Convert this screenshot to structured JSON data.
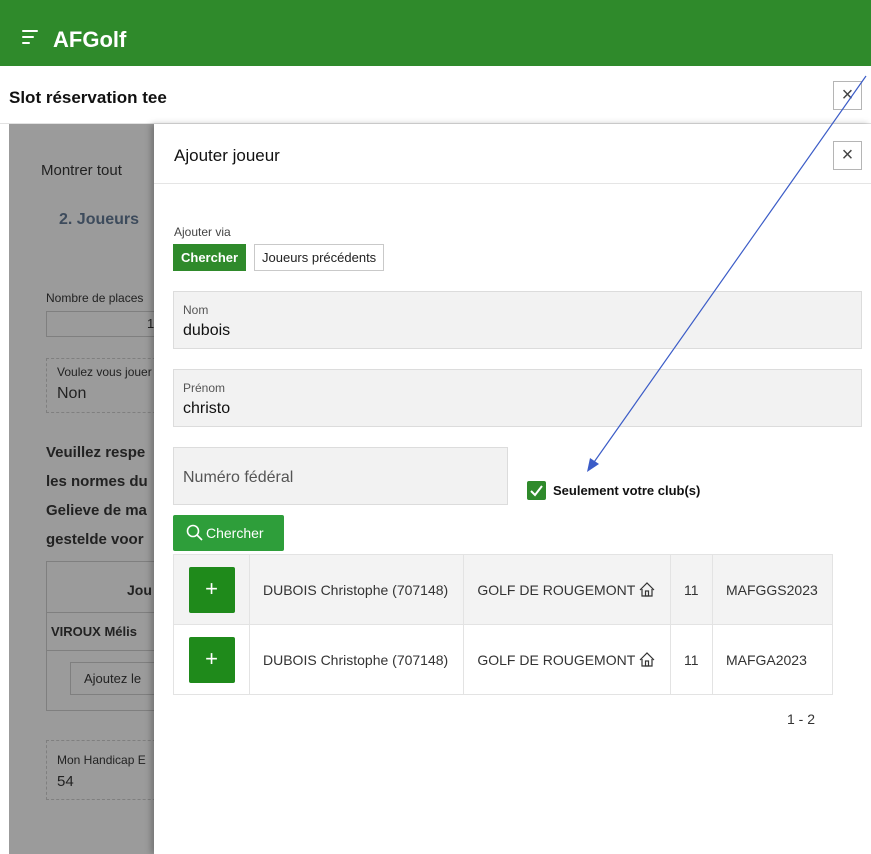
{
  "app": {
    "title": "AFGolf"
  },
  "outer_dialog": {
    "title": "Slot réservation tee",
    "close_label": "×"
  },
  "background": {
    "show_all": "Montrer tout",
    "section_title": "2. Joueurs",
    "places_label": "Nombre de places",
    "places_value": "1",
    "question_label": "Voulez vous jouer",
    "question_value": "Non",
    "notice_lines": [
      "Veuillez respe",
      "les normes du",
      "Gelieve de ma",
      "gestelde voor"
    ],
    "table_header": "Jou",
    "player_row": "VIROUX Mélis",
    "add_button": "Ajoutez le",
    "handicap_label": "Mon Handicap E",
    "handicap_value": "54"
  },
  "dialog": {
    "title": "Ajouter joueur",
    "close_label": "×",
    "add_via_label": "Ajouter via",
    "tabs": [
      {
        "label": "Chercher",
        "active": true
      },
      {
        "label": "Joueurs précédents",
        "active": false
      }
    ],
    "fields": {
      "nom": {
        "label": "Nom",
        "value": "dubois"
      },
      "prenom": {
        "label": "Prénom",
        "value": "christo"
      },
      "numero": {
        "placeholder": "Numéro fédéral"
      }
    },
    "only_club": {
      "label": "Seulement votre club(s)",
      "checked": true
    },
    "search_button": "Chercher",
    "results": [
      {
        "add": "+",
        "name": "DUBOIS Christophe (707148)",
        "club": "GOLF DE ROUGEMONT",
        "handicap": "11",
        "code": "MAFGGS2023"
      },
      {
        "add": "+",
        "name": "DUBOIS Christophe (707148)",
        "club": "GOLF DE ROUGEMONT",
        "handicap": "11",
        "code": "MAFGA2023"
      }
    ],
    "pagination": "1 - 2"
  },
  "colors": {
    "brand_green": "#2f8a2b",
    "button_green": "#2e9e3a",
    "overlay_gray": "#9b9b9b",
    "annotation_arrow": "#3b5cc7"
  },
  "icons": {
    "menu": "hamburger-icon",
    "close": "close-icon",
    "search": "search-icon",
    "home": "home-icon",
    "check": "check-icon"
  }
}
